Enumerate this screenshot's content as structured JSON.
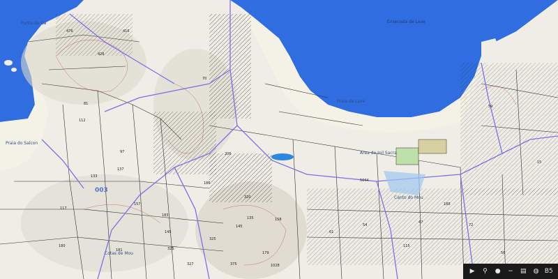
{
  "map": {
    "water_color": "#2f6de0",
    "land_color": "#efede6",
    "beach_color": "#f4f1e6",
    "parcel_line_color": "#2c2c2c",
    "road_color": "#7a70e8",
    "contour_color": "#c04040",
    "pond_color": "#2a88e0",
    "place_labels": {
      "punta": "Punta de Ca",
      "ensenada": "Ensenada de Laxe",
      "playa_top": "Praia de Laxe",
      "area_sur": "Area de Inil Sacra",
      "pedra": "Praia do Salcon",
      "canto": "Canto do Mou",
      "cotas": "Cotas de Mou",
      "sector": "003"
    },
    "plot_numbers": {
      "p1": "476",
      "p2": "416",
      "p3": "426",
      "p4": "70",
      "p5": "112",
      "p6": "133",
      "p7": "97",
      "p8": "137",
      "p9": "206",
      "p10": "320",
      "p11": "325",
      "p12": "135",
      "p13": "145",
      "p14": "179",
      "p15": "183",
      "p16": "327",
      "p17": "186",
      "p18": "158",
      "p19": "1028",
      "p20": "5044",
      "p21": "47",
      "p22": "61",
      "p23": "188",
      "p24": "325",
      "p25": "375",
      "p26": "181",
      "p27": "157",
      "p28": "180",
      "p29": "117",
      "p30": "72",
      "p31": "56",
      "p32": "130",
      "p33": "54",
      "p34": "115",
      "p35": "81",
      "p36": "145",
      "p37": "15",
      "p38": "59"
    }
  },
  "toolbar": {
    "buttons": [
      {
        "name": "play-icon",
        "glyph": "▶"
      },
      {
        "name": "zoom-icon",
        "glyph": "⚲"
      },
      {
        "name": "layers-icon",
        "glyph": "●"
      },
      {
        "name": "minus-icon",
        "glyph": "−"
      },
      {
        "name": "print-icon",
        "glyph": "▤"
      },
      {
        "name": "info-icon",
        "glyph": "◍"
      },
      {
        "name": "scale-label",
        "glyph": "B5"
      }
    ]
  }
}
